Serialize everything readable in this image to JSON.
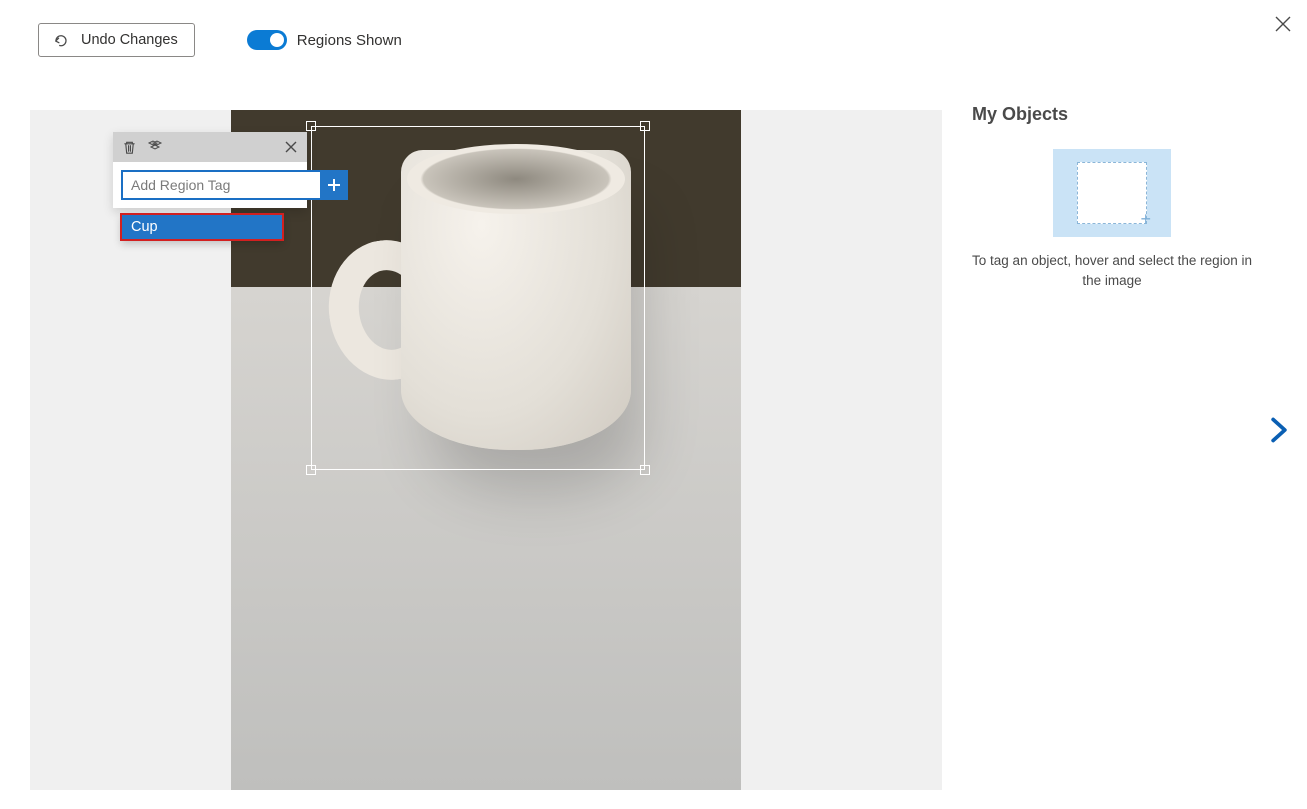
{
  "topbar": {
    "undo_label": "Undo Changes",
    "toggle_label": "Regions Shown"
  },
  "tag_panel": {
    "placeholder": "Add Region Tag",
    "suggestion": "Cup"
  },
  "side": {
    "title": "My Objects",
    "help": "To tag an object, hover and select the region in the image"
  }
}
